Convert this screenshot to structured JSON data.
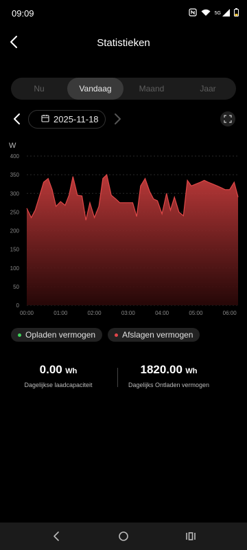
{
  "status": {
    "time": "09:09",
    "icons": [
      "nfc-icon",
      "wifi-icon",
      "5g-icon",
      "signal-icon",
      "battery-icon"
    ],
    "network": "5G"
  },
  "header": {
    "title": "Statistieken",
    "back_icon": "arrow-left-icon"
  },
  "tabs": [
    {
      "label": "Nu",
      "active": false
    },
    {
      "label": "Vandaag",
      "active": true
    },
    {
      "label": "Maand",
      "active": false
    },
    {
      "label": "Jaar",
      "active": false
    }
  ],
  "date": {
    "value": "2025-11-18"
  },
  "chart_data": {
    "type": "area",
    "ylabel": "W",
    "xlabel": "",
    "ylim": [
      0,
      400
    ],
    "yticks": [
      0,
      50,
      100,
      150,
      200,
      250,
      300,
      350,
      400
    ],
    "xlim": [
      "00:00",
      "06:15"
    ],
    "xticks": [
      "00:00",
      "01:00",
      "02:00",
      "03:00",
      "04:00",
      "05:00",
      "06:00"
    ],
    "series": [
      {
        "name": "Afslagen vermogen",
        "color": "#c43c3c",
        "x": [
          "00:00",
          "00:08",
          "00:15",
          "00:22",
          "00:30",
          "00:38",
          "00:45",
          "00:52",
          "01:00",
          "01:08",
          "01:15",
          "01:22",
          "01:30",
          "01:38",
          "01:45",
          "01:52",
          "02:00",
          "02:08",
          "02:15",
          "02:22",
          "02:30",
          "02:38",
          "02:45",
          "02:52",
          "03:00",
          "03:08",
          "03:15",
          "03:22",
          "03:30",
          "03:38",
          "03:45",
          "03:52",
          "04:00",
          "04:08",
          "04:15",
          "04:22",
          "04:30",
          "04:38",
          "04:45",
          "04:52",
          "05:00",
          "05:08",
          "05:15",
          "05:22",
          "05:30",
          "05:38",
          "05:45",
          "05:52",
          "06:00",
          "06:08",
          "06:15"
        ],
        "values": [
          260,
          235,
          255,
          290,
          330,
          340,
          310,
          265,
          278,
          268,
          295,
          345,
          295,
          293,
          228,
          275,
          235,
          265,
          340,
          350,
          295,
          285,
          275,
          275,
          275,
          275,
          238,
          320,
          340,
          305,
          285,
          280,
          245,
          300,
          255,
          290,
          250,
          240,
          335,
          320,
          325,
          330,
          335,
          330,
          325,
          320,
          315,
          310,
          310,
          330,
          290
        ]
      },
      {
        "name": "Opladen vermogen",
        "color": "#3fd25a",
        "x": [
          "00:00",
          "06:15"
        ],
        "values": [
          0,
          0
        ]
      }
    ],
    "legend": "bottom-left"
  },
  "legend": [
    {
      "label": "Opladen vermogen",
      "color": "#3fd25a"
    },
    {
      "label": "Afslagen vermogen",
      "color": "#e0454a"
    }
  ],
  "stats": [
    {
      "value": "0.00",
      "unit": "Wh",
      "label": "Dagelijkse laadcapaciteit"
    },
    {
      "value": "1820.00",
      "unit": "Wh",
      "label": "Dagelijks Ontladen vermogen"
    }
  ],
  "nav": {
    "icons": [
      "back-nav-icon",
      "home-nav-icon",
      "recents-nav-icon"
    ]
  }
}
